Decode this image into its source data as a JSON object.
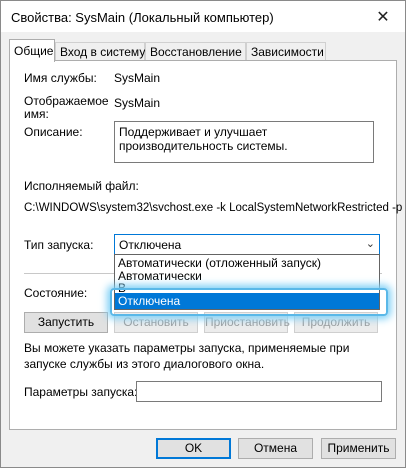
{
  "window": {
    "title": "Свойства: SysMain (Локальный компьютер)"
  },
  "tabs": [
    {
      "label": "Общие"
    },
    {
      "label": "Вход в систему"
    },
    {
      "label": "Восстановление"
    },
    {
      "label": "Зависимости"
    }
  ],
  "general": {
    "service_name_label": "Имя службы:",
    "service_name_value": "SysMain",
    "display_name_label_1": "Отображаемое",
    "display_name_label_2": "имя:",
    "display_name_value": "SysMain",
    "description_label": "Описание:",
    "description_value": "Поддерживает и улучшает производительность системы.",
    "exe_label": "Исполняемый файл:",
    "exe_value": "C:\\WINDOWS\\system32\\svchost.exe -k LocalSystemNetworkRestricted -p",
    "startup_label": "Тип запуска:",
    "startup_value": "Отключена",
    "startup_options": [
      "Автоматически (отложенный запуск)",
      "Автоматически",
      "В",
      "Отключена"
    ],
    "status_label": "Состояние:",
    "buttons": {
      "start": "Запустить",
      "stop": "Остановить",
      "pause": "Приостановить",
      "resume": "Продолжить"
    },
    "hint": "Вы можете указать параметры запуска, применяемые при запуске службы из этого диалогового окна.",
    "params_label": "Параметры запуска:",
    "params_value": ""
  },
  "footer": {
    "ok": "OK",
    "cancel": "Отмена",
    "apply": "Применить"
  }
}
